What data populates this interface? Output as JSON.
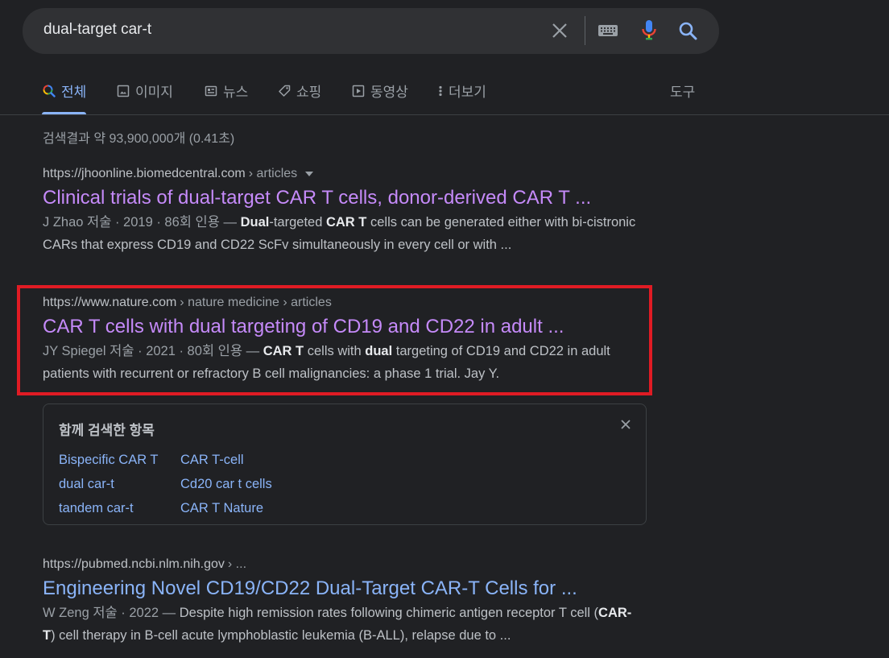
{
  "search": {
    "query": "dual-target car-t"
  },
  "tabs": [
    {
      "label": "전체",
      "icon": "search-icon",
      "active": true
    },
    {
      "label": "이미지",
      "icon": "image-icon"
    },
    {
      "label": "뉴스",
      "icon": "news-icon"
    },
    {
      "label": "쇼핑",
      "icon": "tag-icon"
    },
    {
      "label": "동영상",
      "icon": "play-icon"
    },
    {
      "label": "더보기",
      "icon": "more-vert-icon"
    },
    {
      "label": "도구",
      "icon": ""
    }
  ],
  "stats": "검색결과 약 93,900,000개 (0.41초)",
  "results": [
    {
      "url_domain": "https://jhoonline.biomedcentral.com",
      "url_path": " › articles",
      "title": "Clinical trials of dual-target CAR T cells, donor-derived CAR T ...",
      "meta": "J Zhao 저술 · 2019 · 86회 인용 — ",
      "snippet_b1": "Dual",
      "snippet_t1": "-targeted ",
      "snippet_b2": "CAR T",
      "snippet_t2": " cells can be generated either with bi-cistronic CARs that express CD19 and CD22 ScFv simultaneously in every cell or with ..."
    },
    {
      "url_domain": "https://www.nature.com",
      "url_path": " › nature medicine › articles",
      "title": "CAR T cells with dual targeting of CD19 and CD22 in adult ...",
      "meta": "JY Spiegel 저술 · 2021 · 80회 인용 — ",
      "snippet_b1": "CAR T",
      "snippet_t1": " cells with ",
      "snippet_b2": "dual",
      "snippet_t2": " targeting of CD19 and CD22 in adult patients with recurrent or refractory B cell malignancies: a phase 1 trial. Jay Y."
    },
    {
      "url_domain": "https://pubmed.ncbi.nlm.nih.gov",
      "url_path": " › ...",
      "title": "Engineering Novel CD19/CD22 Dual-Target CAR-T Cells for ...",
      "meta": "W Zeng 저술 · 2022 — ",
      "snippet_t0": "Despite high remission rates following chimeric antigen receptor T cell (",
      "snippet_b1": "CAR-T",
      "snippet_t1": ") cell therapy in B-cell acute lymphoblastic leukemia (B-ALL), relapse due to ..."
    }
  ],
  "related": {
    "title": "함께 검색한 항목",
    "col1": [
      "Bispecific CAR T",
      "dual car-t",
      "tandem car-t"
    ],
    "col2": [
      "CAR T-cell",
      "Cd20 car t cells",
      "CAR T Nature"
    ]
  },
  "colors": {
    "background": "#202124",
    "link": "#8ab4f8",
    "visited_link": "#c58af9",
    "highlight": "#e01b24"
  }
}
